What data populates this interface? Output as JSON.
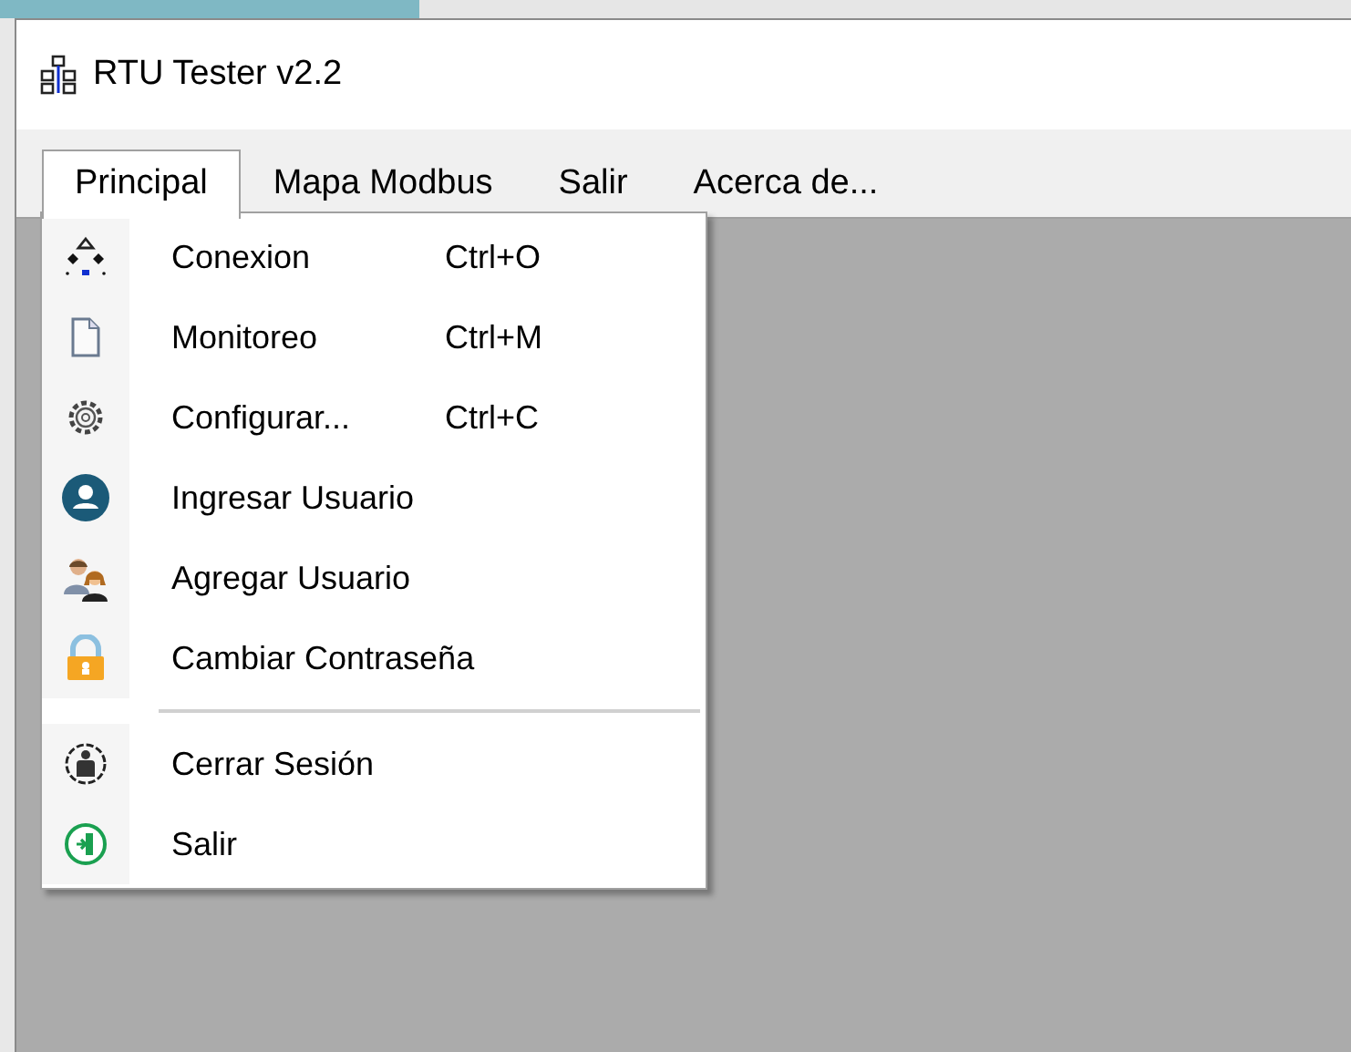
{
  "window": {
    "title": "RTU Tester v2.2"
  },
  "menu_bar": [
    {
      "label": "Principal",
      "selected": true
    },
    {
      "label": "Mapa Modbus",
      "selected": false
    },
    {
      "label": "Salir",
      "selected": false
    },
    {
      "label": "Acerca de...",
      "selected": false
    }
  ],
  "dropdown": {
    "groups": [
      [
        {
          "label": "Conexion",
          "shortcut": "Ctrl+O",
          "kind": "network"
        },
        {
          "label": "Monitoreo",
          "shortcut": "Ctrl+M",
          "kind": "document"
        },
        {
          "label": "Configurar...",
          "shortcut": "Ctrl+C",
          "kind": "gear"
        },
        {
          "label": "Ingresar Usuario",
          "kind": "user-circle"
        },
        {
          "label": "Agregar Usuario",
          "kind": "users"
        },
        {
          "label": "Cambiar Contraseña",
          "kind": "lock"
        }
      ],
      [
        {
          "label": "Cerrar Sesión",
          "kind": "person-circle"
        },
        {
          "label": "Salir",
          "kind": "exit"
        }
      ]
    ]
  }
}
